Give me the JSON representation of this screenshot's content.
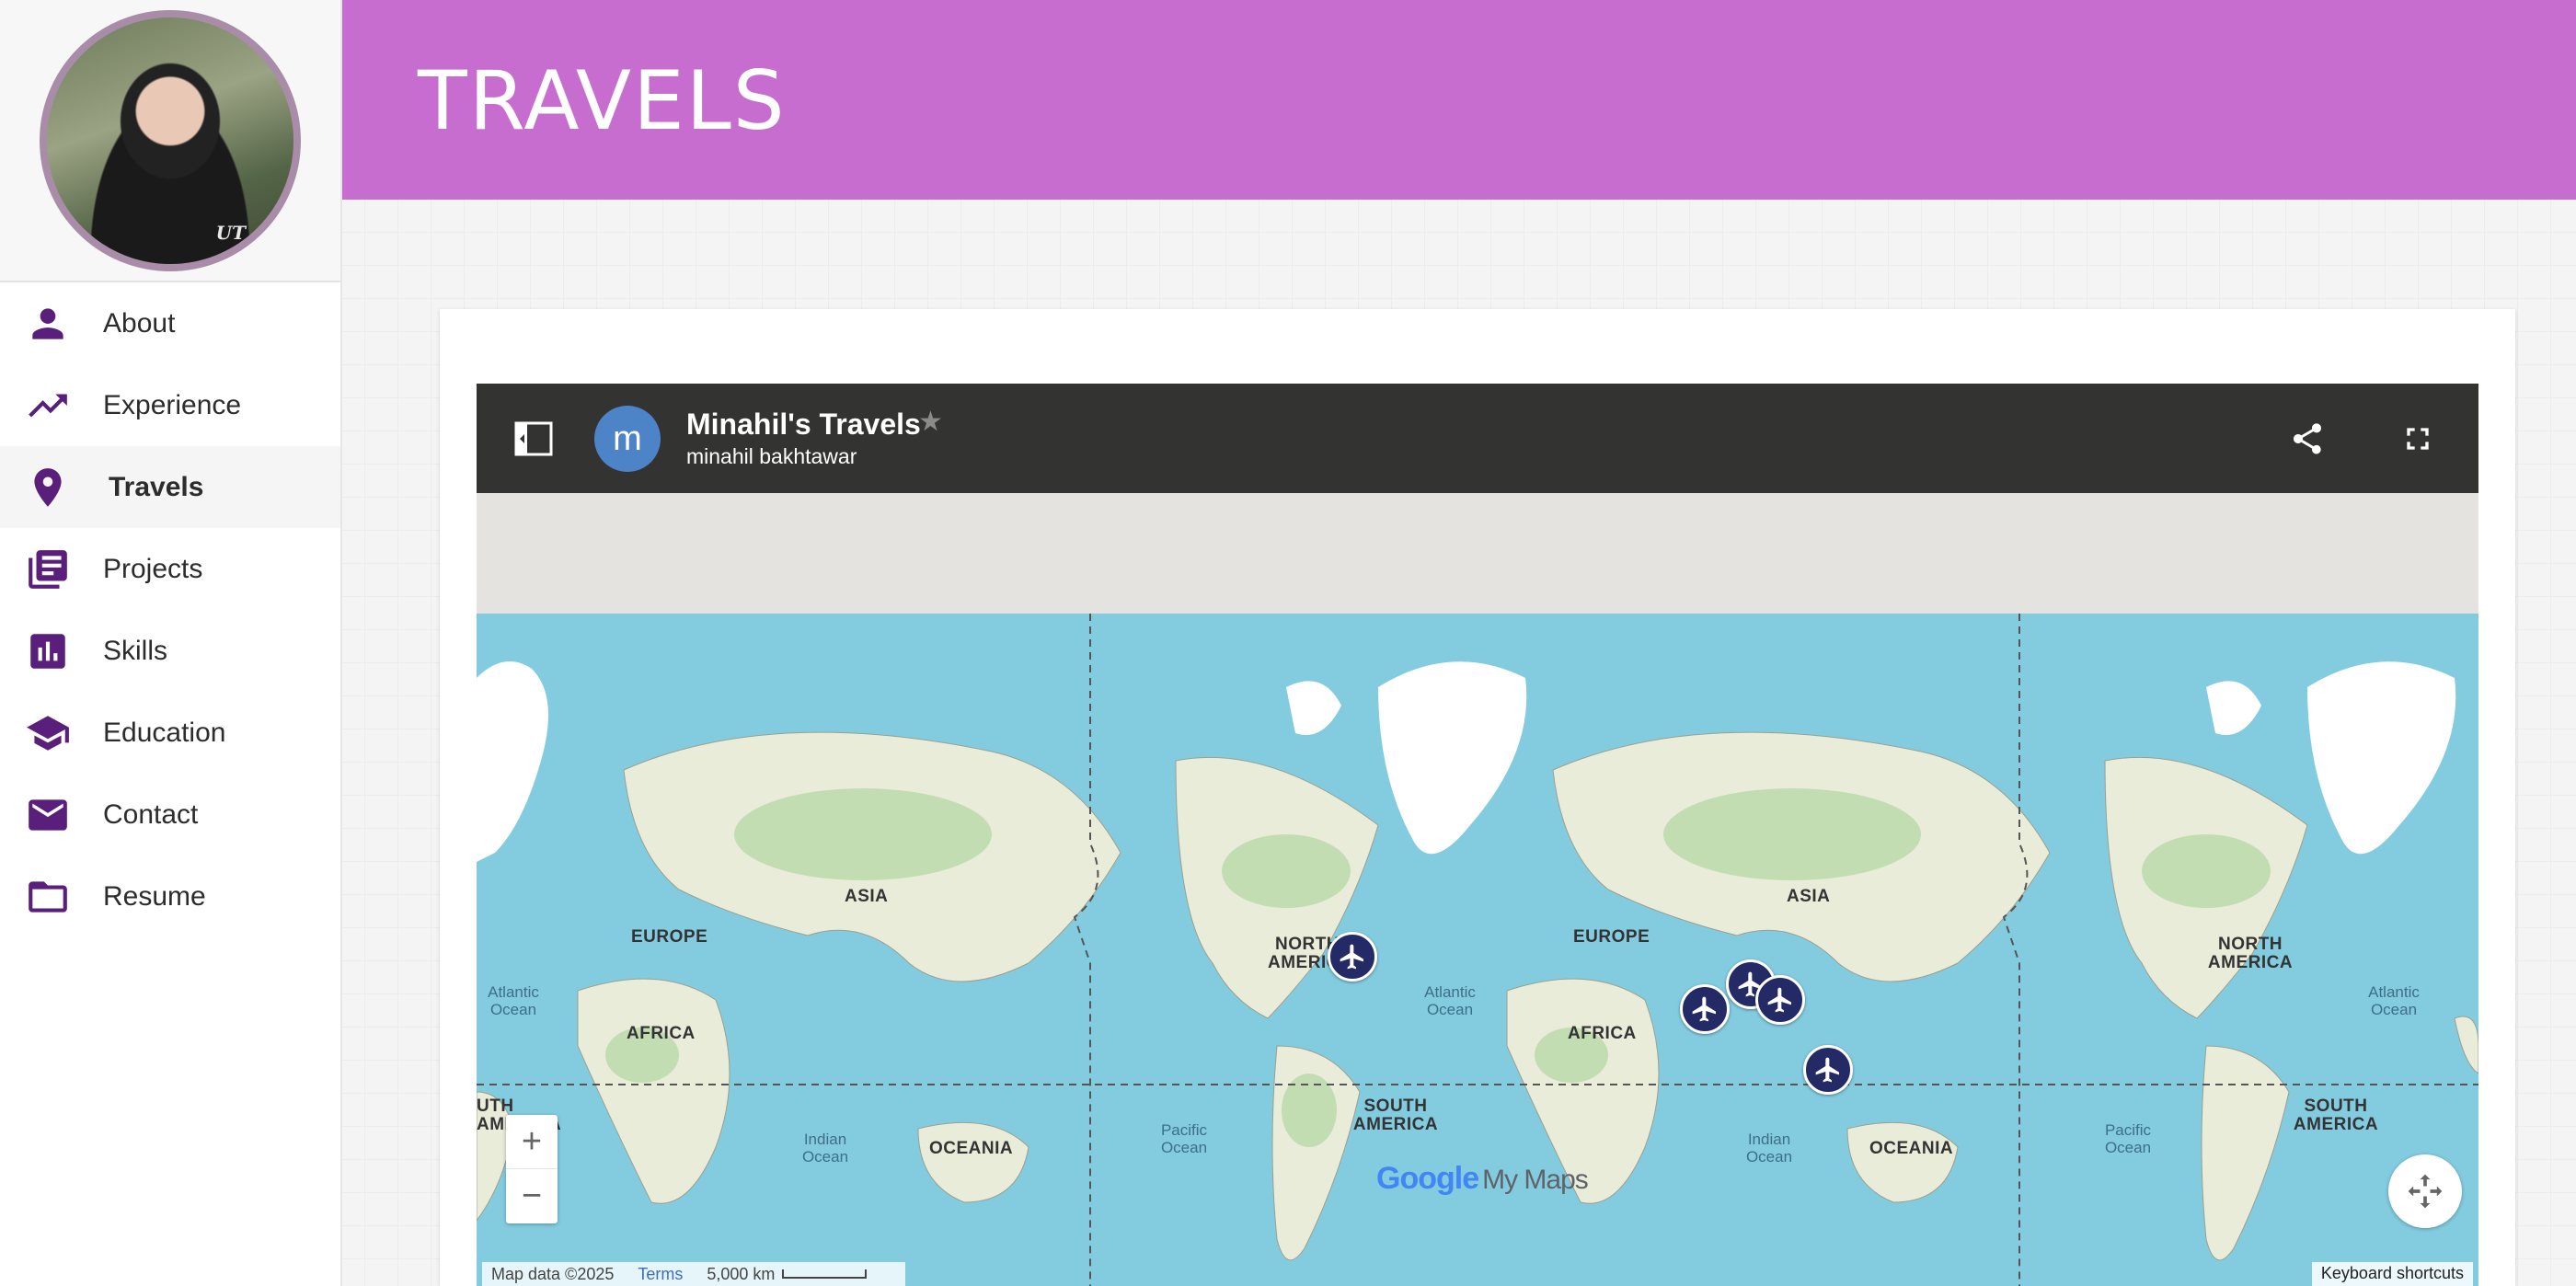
{
  "page": {
    "title": "TRAVELS"
  },
  "sidebar": {
    "avatar_mark": "UT",
    "items": [
      {
        "label": "About",
        "icon": "person-icon"
      },
      {
        "label": "Experience",
        "icon": "trending-up-icon"
      },
      {
        "label": "Travels",
        "icon": "map-pin-icon",
        "active": true
      },
      {
        "label": "Projects",
        "icon": "library-books-icon"
      },
      {
        "label": "Skills",
        "icon": "bar-chart-icon"
      },
      {
        "label": "Education",
        "icon": "graduation-cap-icon"
      },
      {
        "label": "Contact",
        "icon": "mail-icon"
      },
      {
        "label": "Resume",
        "icon": "folder-icon"
      }
    ]
  },
  "map": {
    "title": "Minahil's Travels",
    "owner": "minahil bakhtawar",
    "owner_initial": "m",
    "continent_labels": [
      "ASIA",
      "EUROPE",
      "AFRICA",
      "NORTH AMERICA",
      "SOUTH AMERICA",
      "OCEANIA",
      "ASIA",
      "EUROPE",
      "AFRICA",
      "NORTH AMERICA",
      "SOUTH AMERICA",
      "OCEANIA",
      "UTH AMERICA"
    ],
    "ocean_labels": [
      "Atlantic Ocean",
      "Indian Ocean",
      "Pacific Ocean",
      "Atlantic Ocean",
      "Indian Ocean",
      "Pacific Ocean",
      "Atlantic Ocean"
    ],
    "brand_google": "Google",
    "brand_mymaps": "My Maps",
    "attribution": "Map data ©2025",
    "terms": "Terms",
    "scale": "5,000 km",
    "keyboard_shortcuts": "Keyboard shortcuts",
    "zoom_in": "+",
    "zoom_out": "−"
  },
  "colors": {
    "header": "#c86dd0",
    "nav_icon": "#5a1f7a",
    "ocean": "#83cce0",
    "pin": "#242a66"
  }
}
